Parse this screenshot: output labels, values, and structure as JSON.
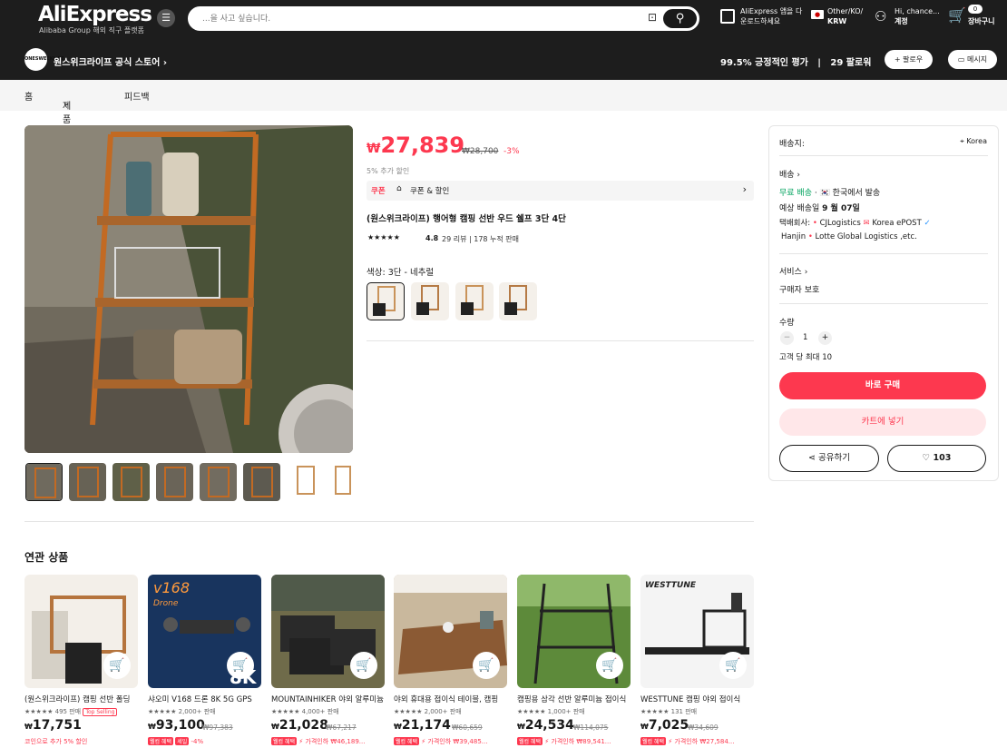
{
  "header": {
    "logo": "AliExpress",
    "logo_sub": "Alibaba Group 해외 직구 플랫폼",
    "search_placeholder": "...을 사고 싶습니다.",
    "app_line1": "AliExpress 앱을 다",
    "app_line2": "운로드하세요",
    "region_line1": "Other/KO/",
    "region_line2": "KRW",
    "account_line1": "Hi, chance...",
    "account_line2": "계정",
    "cart_count": "0",
    "cart_label": "장바구니"
  },
  "store": {
    "avatar": "ONESWEEKLIFE",
    "name": "원스위크라이프 공식 스토어",
    "rating": "99.5% 긍정적인 평가",
    "followers": "29 팔로워",
    "follow_btn": "+ 팔로우",
    "message_btn": "메시지"
  },
  "nav": {
    "home": "홈",
    "products": "제품",
    "feedback": "피드백"
  },
  "product": {
    "currency": "₩",
    "price": "27,839",
    "old_price": "₩28,700",
    "discount": "-3%",
    "extra_discount": "5% 추가 할인",
    "coupon_tag": "쿠폰",
    "coupon_text": "쿠폰 & 할인",
    "title": "(원스위크라이프) 행어형 캠핑 선반 우드 쉘프 3단 4단",
    "rating": "4.8",
    "reviews": "29 리뷰",
    "sold": "178 누적 판매",
    "option_label": "색상: 3단 - 네추럴"
  },
  "side": {
    "ship_to_label": "배송지:",
    "ship_to_value": "Korea",
    "delivery_label": "배송",
    "free_shipping": "무료 배송",
    "ship_from": "한국에서 발송",
    "eta_prefix": "예상 배송일",
    "eta_date": "9 월 07일",
    "courier_label": "택배회사:",
    "courier1": "CJLogistics",
    "courier2": "Korea ePOST",
    "courier3": "Hanjin",
    "courier4": "Lotte Global Logistics ,etc.",
    "service_label": "서비스",
    "service_value": "구매자 보호",
    "qty_label": "수량",
    "qty_value": "1",
    "qty_max": "고객 당 최대 10",
    "buy_now": "바로 구매",
    "add_cart": "카트에 넣기",
    "share": "공유하기",
    "wishlist_count": "103"
  },
  "related": {
    "heading": "연관 상품",
    "items": [
      {
        "name": "(원스위크라이프) 캠핑 선반 폴딩",
        "sold": "495 판매",
        "badge": "Top Selling",
        "price": "17,751",
        "old": "",
        "tag": "코인으로 추가 5% 할인",
        "deal": "",
        "extra": ""
      },
      {
        "name": "샤오미 V168 드론 8K 5G GPS",
        "sold": "2,000+ 판매",
        "badge": "",
        "price": "93,100",
        "old": "₩97,383",
        "tag": "-4%",
        "deal": "웰컴 혜택",
        "extra": "세일"
      },
      {
        "name": "MOUNTAINHIKER 야외 알루미늄",
        "sold": "4,000+ 판매",
        "badge": "",
        "price": "21,028",
        "old": "₩67,217",
        "tag": "가격인하 ₩46,189...",
        "deal": "웰컴 혜택",
        "extra": ""
      },
      {
        "name": "야외 휴대용 접이식 테이블, 캠핑",
        "sold": "2,000+ 판매",
        "badge": "",
        "price": "21,174",
        "old": "₩60,659",
        "tag": "가격인하 ₩39,485...",
        "deal": "웰컴 혜택",
        "extra": ""
      },
      {
        "name": "캠핑용 삼각 선반 알루미늄 접이식",
        "sold": "1,000+ 판매",
        "badge": "",
        "price": "24,534",
        "old": "₩114,075",
        "tag": "가격인하 ₩89,541...",
        "deal": "웰컴 혜택",
        "extra": ""
      },
      {
        "name": "WESTTUNE 캠핑 야외 접이식",
        "sold": "131 판매",
        "badge": "",
        "price": "7,025",
        "old": "₩34,609",
        "tag": "가격인하 ₩27,584...",
        "deal": "웰컴 혜택",
        "extra": ""
      }
    ]
  },
  "colors": {
    "accent": "#fd384f",
    "header_bg": "#1d1d1d",
    "free_shipping": "#00a35e"
  }
}
